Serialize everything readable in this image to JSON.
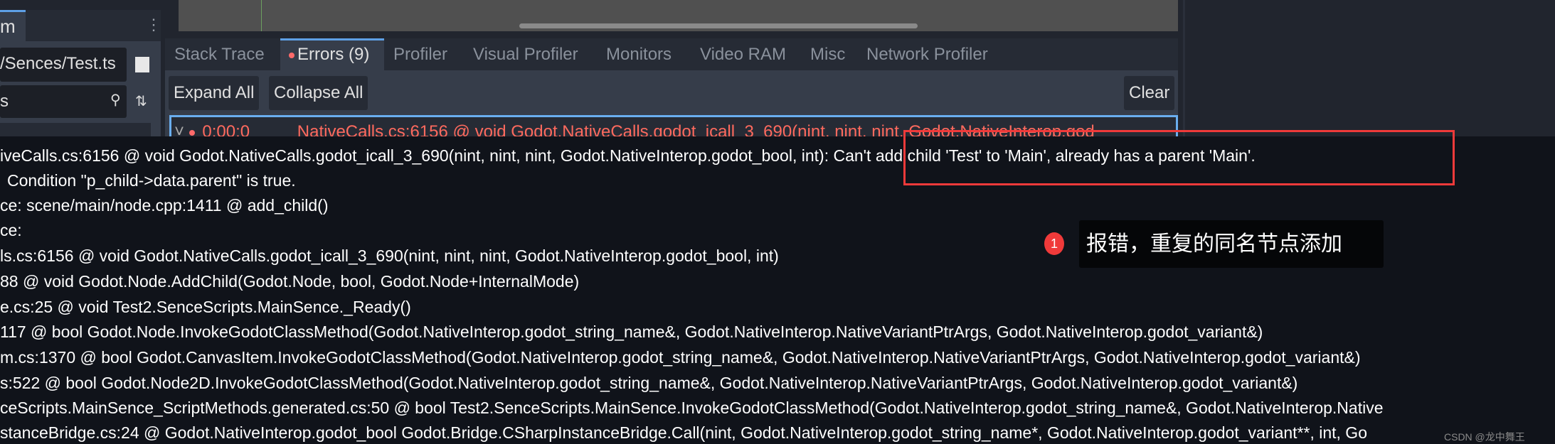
{
  "left_panel": {
    "tab_label": "m",
    "path_value": "/Sences/Test.ts",
    "filter_value": "s",
    "icons": [
      "more-vertical-icon",
      "checkbox-icon",
      "search-icon",
      "sort-icon"
    ]
  },
  "debugger": {
    "tabs": [
      {
        "label": "Stack Trace",
        "active": false
      },
      {
        "label": "Errors (9)",
        "active": true
      },
      {
        "label": "Profiler",
        "active": false
      },
      {
        "label": "Visual Profiler",
        "active": false
      },
      {
        "label": "Monitors",
        "active": false
      },
      {
        "label": "Video RAM",
        "active": false
      },
      {
        "label": "Misc",
        "active": false
      },
      {
        "label": "Network Profiler",
        "active": false
      }
    ],
    "expand_all": "Expand All",
    "collapse_all": "Collapse All",
    "clear": "Clear",
    "error_row": {
      "time": "0:00:0",
      "message": "NativeCalls.cs:6156 @ void Godot.NativeCalls.godot_icall_3_690(nint, nint, nint, Godot.NativeInterop.god"
    },
    "error_color": "#ff6a5e",
    "accent": "#5ea0e6"
  },
  "tooltip_lines": [
    "iveCalls.cs:6156 @ void Godot.NativeCalls.godot_icall_3_690(nint, nint, nint, Godot.NativeInterop.godot_bool, int): Can't add child 'Test' to 'Main', already has a parent 'Main'.",
    " Condition \"p_child->data.parent\" is true.",
    "ce: scene/main/node.cpp:1411 @ add_child()",
    "ce:",
    "ls.cs:6156 @ void Godot.NativeCalls.godot_icall_3_690(nint, nint, nint, Godot.NativeInterop.godot_bool, int)",
    "88 @ void Godot.Node.AddChild(Godot.Node, bool, Godot.Node+InternalMode)",
    "e.cs:25 @ void Test2.SenceScripts.MainSence._Ready()",
    "117 @ bool Godot.Node.InvokeGodotClassMethod(Godot.NativeInterop.godot_string_name&, Godot.NativeInterop.NativeVariantPtrArgs, Godot.NativeInterop.godot_variant&)",
    "m.cs:1370 @ bool Godot.CanvasItem.InvokeGodotClassMethod(Godot.NativeInterop.godot_string_name&, Godot.NativeInterop.NativeVariantPtrArgs, Godot.NativeInterop.godot_variant&)",
    "s:522 @ bool Godot.Node2D.InvokeGodotClassMethod(Godot.NativeInterop.godot_string_name&, Godot.NativeInterop.NativeVariantPtrArgs, Godot.NativeInterop.godot_variant&)",
    "ceScripts.MainSence_ScriptMethods.generated.cs:50 @ bool Test2.SenceScripts.MainSence.InvokeGodotClassMethod(Godot.NativeInterop.godot_string_name&, Godot.NativeInterop.Native",
    "stanceBridge.cs:24 @ Godot.NativeInterop.godot_bool Godot.Bridge.CSharpInstanceBridge.Call(nint, Godot.NativeInterop.godot_string_name*, Godot.NativeInterop.godot_variant**, int, Go"
  ],
  "annotation": {
    "number": "1",
    "text": "报错，重复的同名节点添加",
    "color": "#f03a3a"
  },
  "watermark": "CSDN @龙中舞王"
}
